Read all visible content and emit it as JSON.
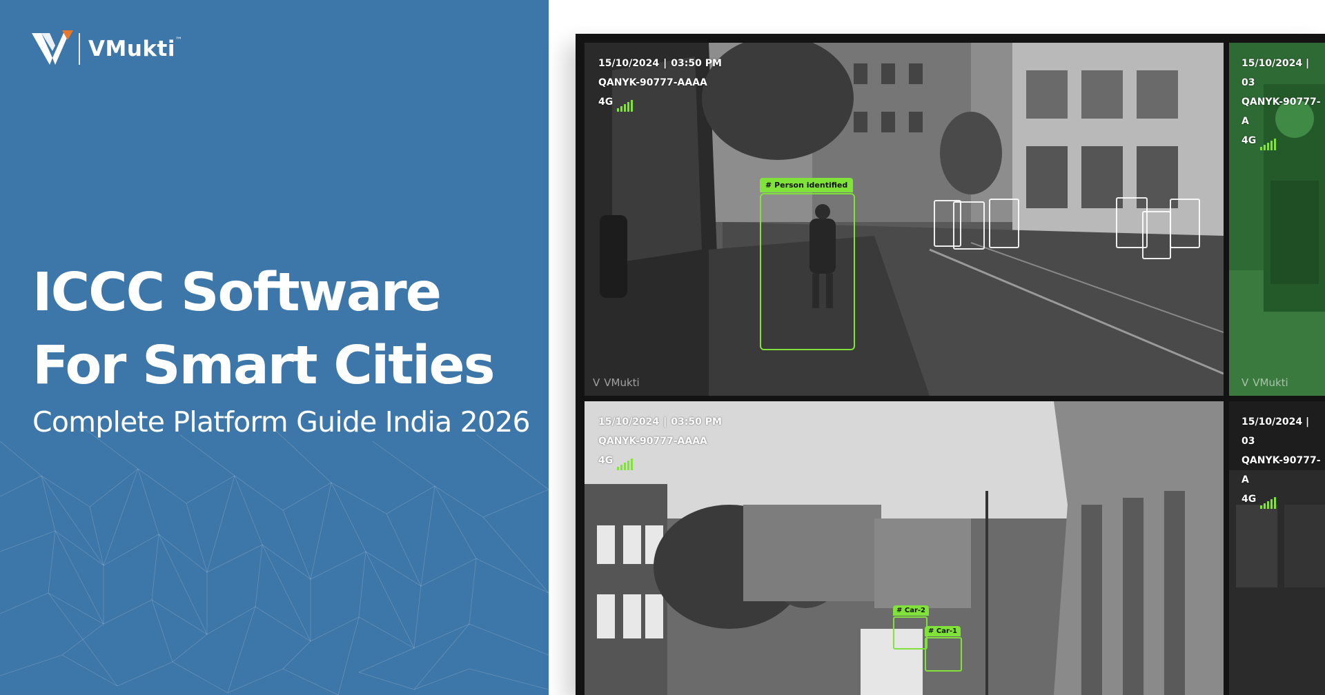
{
  "brand": {
    "name": "VMukti",
    "trademark": "™",
    "logo_icon": "vmukti-v-logo-icon",
    "accent_color": "#e8782a"
  },
  "hero": {
    "headline_line1": "ICCC Software",
    "headline_line2": "For Smart Cities",
    "subtitle": "Complete Platform Guide India 2026",
    "panel_color": "#3d76a8"
  },
  "camera_overlay": {
    "date": "15/10/2024",
    "time": "03:50 PM",
    "camera_id": "QANYK-90777-AAAA",
    "camera_id_cropped": "QANYK-90777-A",
    "camera_id_cropped_2": "QANYK-90777-A",
    "date_time_cropped": "15/10/2024 | 03",
    "network": "4G",
    "signal_icon": "signal-bars-icon",
    "signal_color": "#7fe33a",
    "watermark": "VMukti"
  },
  "detections": {
    "person": "# Person identified",
    "car_2": "# Car-2",
    "car_1": "# Car-1"
  }
}
